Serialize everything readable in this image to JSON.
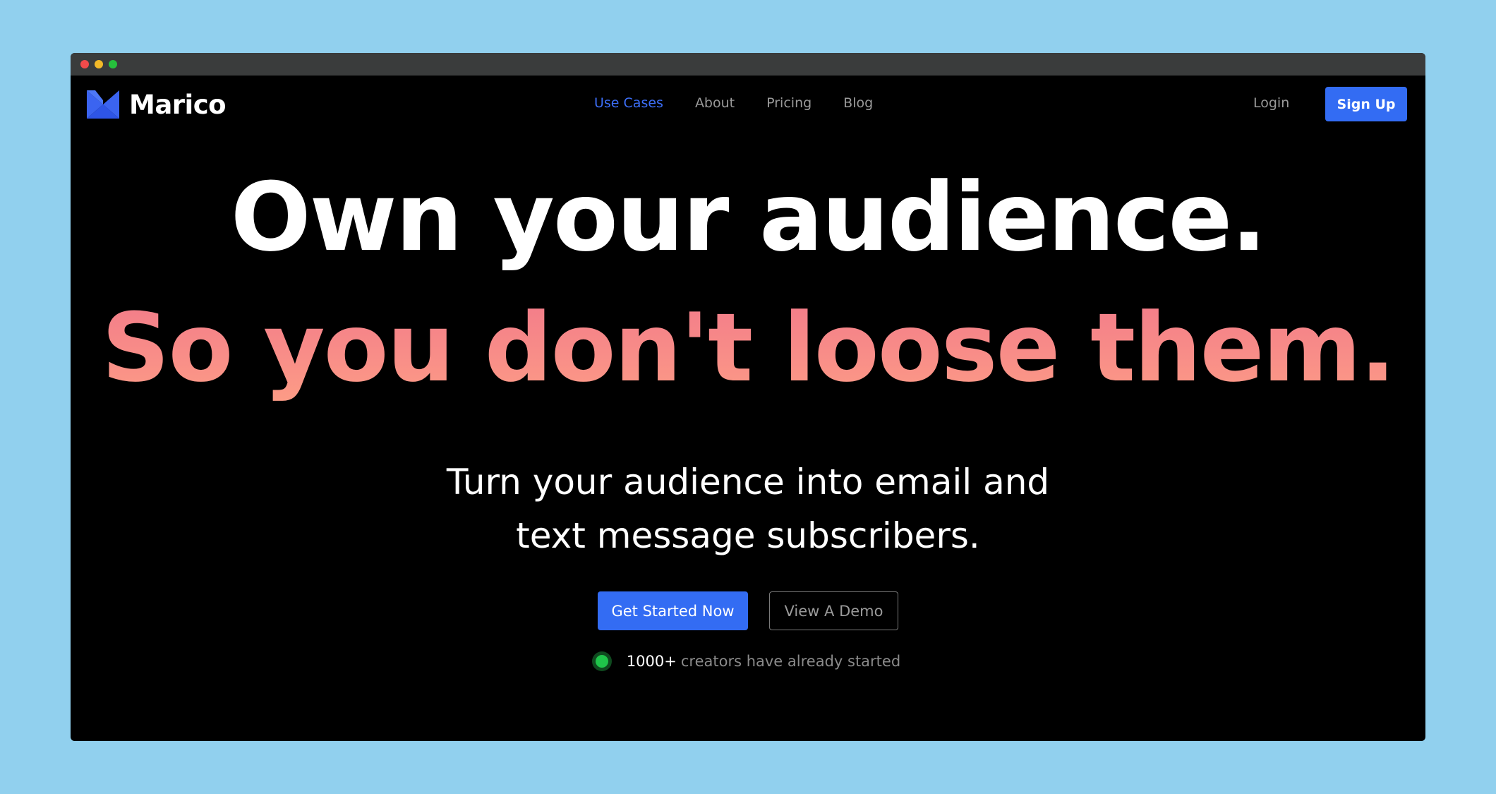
{
  "brand": {
    "name": "Marico",
    "logo_icon": "m-logo-icon",
    "accent_color": "#336cf3"
  },
  "nav": {
    "links": [
      {
        "label": "Use Cases",
        "active": true
      },
      {
        "label": "About",
        "active": false
      },
      {
        "label": "Pricing",
        "active": false
      },
      {
        "label": "Blog",
        "active": false
      }
    ],
    "login_label": "Login",
    "signup_label": "Sign Up"
  },
  "hero": {
    "headline_line1": "Own your audience.",
    "headline_line2": "So you don't loose them.",
    "subtitle_line1": "Turn your audience into email and",
    "subtitle_line2": "text message subscribers.",
    "primary_cta": "Get Started Now",
    "secondary_cta": "View A Demo",
    "social_proof_count": "1000+",
    "social_proof_text": "creators have already started",
    "status_color": "#1fc54a"
  }
}
